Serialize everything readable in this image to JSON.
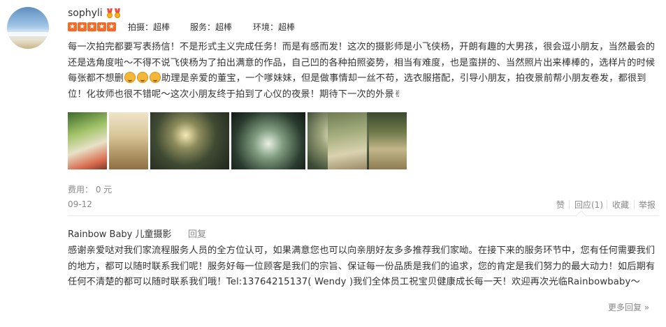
{
  "review": {
    "username": "sophyli",
    "rating_stars": 5,
    "ratings": [
      {
        "label": "拍摄：超棒"
      },
      {
        "label": "服务：超棒"
      },
      {
        "label": "环境：超棒"
      }
    ],
    "text_part1": "每一次拍完都要写表扬信！不是形式主义完成任务！而是有感而发！这次的摄影师是小飞侠杨，开朗有趣的大男孩，很会逗小朋友，当然最会的还是选角度啦～不得不说飞侠杨为了拍出满意的作品，自己凹的各种拍照姿势，相当有难度，也是蛮拼的、当然照片出来棒棒的，选样片的时候每张都不想删",
    "text_part2": "助理是亲爱的董宝，一个嗲妹妹，但是做事情却一丝不苟，选衣服搭配，引导小朋友，拍夜景前帮小朋友卷发，都很到位！化妆师也很不错呢～这次小朋友终于拍到了心仪的夜景！期待下一次的外景✌",
    "cost": "费用： 0 元",
    "date": "09-12",
    "actions": {
      "like": "赞",
      "reply": "回应(1)",
      "favorite": "收藏",
      "report": "举报"
    }
  },
  "reply": {
    "author": "Rainbow Baby 儿童摄影",
    "reply_label": "回复",
    "text": "感谢亲爱哒对我们家流程服务人员的全方位认可，如果满意您也可以向亲朋好友多多推荐我们家呦。在接下来的服务环节中，您有任何需要我们的地方，都可以随时联系我们呢！服务好每一位顾客是我们的宗旨、保证每一份品质是我们的追求，您的肯定是我们努力的最大动力！如后期有任何不清楚的都可以随时联系我们哦！Tel:13764215137( Wendy )我们全体员工祝宝贝健康成长每一天！欢迎再次光临Rainbowbaby～",
    "more": "更多回复 »"
  },
  "colors": {
    "star_bg": "#f46c2a",
    "text": "#333333",
    "muted": "#888888"
  }
}
